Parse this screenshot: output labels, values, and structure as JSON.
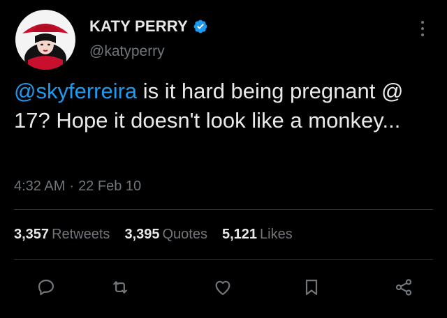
{
  "author": {
    "display_name": "KATY PERRY",
    "handle": "@katyperry",
    "avatar_icon": "profile-photo-icon",
    "verified_icon": "verified-badge-icon",
    "verified_color": "#1d9bf0"
  },
  "tweet": {
    "mention": "@skyferreira",
    "text": " is it hard being pregnant @ 17? Hope it doesn't look like a monkey...",
    "time": "4:32 AM",
    "separator": "·",
    "date": "22 Feb 10"
  },
  "stats": {
    "retweets": {
      "count": "3,357",
      "label": "Retweets"
    },
    "quotes": {
      "count": "3,395",
      "label": "Quotes"
    },
    "likes": {
      "count": "5,121",
      "label": "Likes"
    }
  },
  "actions": [
    {
      "icon": "reply-icon"
    },
    {
      "icon": "retweet-icon"
    },
    {
      "icon": "like-icon"
    },
    {
      "icon": "bookmark-icon"
    },
    {
      "icon": "share-icon"
    }
  ],
  "colors": {
    "background": "#000000",
    "text_primary": "#e7e9ea",
    "text_secondary": "#71767b",
    "link": "#1d9bf0",
    "divider": "#2f3336"
  }
}
